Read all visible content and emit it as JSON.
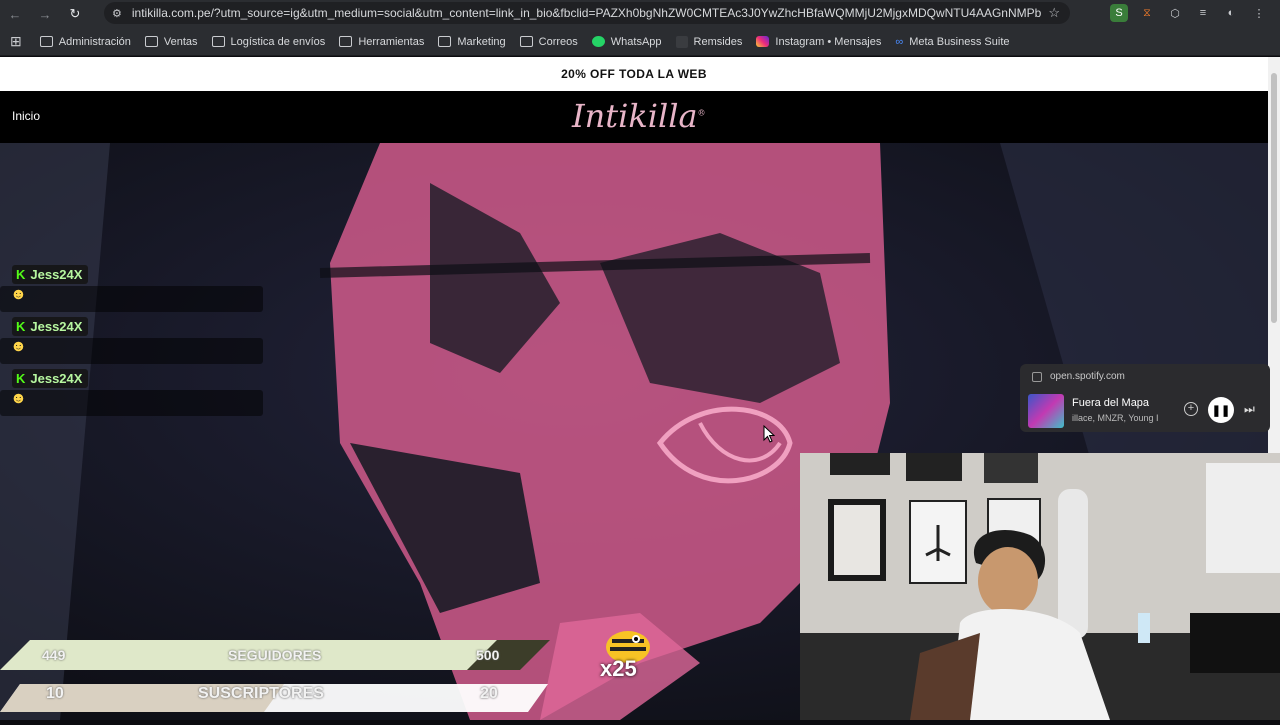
{
  "browser": {
    "url": "intikilla.com.pe/?utm_source=ig&utm_medium=social&utm_content=link_in_bio&fbclid=PAZXh0bgNhZW0CMTEAc3J0YwZhcHBfaWQMMjU2MjgxMDQwNTU4AAGnNMPbuFk...",
    "nav_back": "←",
    "nav_forward": "→",
    "nav_reload": "↻",
    "site_info": "⚙",
    "bookmark_star": "☆",
    "apps_icon": "⊞",
    "extensions": [
      "S",
      "⧖",
      "⬡",
      "≡",
      "◐",
      "⋮"
    ]
  },
  "bookmarks": [
    {
      "label": "Administración",
      "icon": "folder-icon"
    },
    {
      "label": "Ventas",
      "icon": "folder-icon"
    },
    {
      "label": "Logística de envíos",
      "icon": "folder-icon"
    },
    {
      "label": "Herramientas",
      "icon": "folder-icon"
    },
    {
      "label": "Marketing",
      "icon": "folder-icon"
    },
    {
      "label": "Correos",
      "icon": "folder-icon"
    },
    {
      "label": "WhatsApp",
      "icon": "whatsapp-icon"
    },
    {
      "label": "Remsides",
      "icon": "remsides-icon"
    },
    {
      "label": "Instagram • Mensajes",
      "icon": "instagram-icon"
    },
    {
      "label": "Meta Business Suite",
      "icon": "meta-icon"
    }
  ],
  "site": {
    "promo": "20% OFF TODA LA WEB",
    "nav_home": "Inicio",
    "logo": "Intikilla",
    "logo_mark": "®"
  },
  "chat": [
    {
      "badge": "K",
      "user": "Jess24X",
      "emote": "☻"
    },
    {
      "badge": "K",
      "user": "Jess24X",
      "emote": "☻"
    },
    {
      "badge": "K",
      "user": "Jess24X",
      "emote": "☻"
    }
  ],
  "spotify": {
    "source": "open.spotify.com",
    "track": "Fuera del Mapa",
    "artists": "illace, MNZR, Young I",
    "add": "+",
    "pause": "❚❚",
    "next": "⏭"
  },
  "overlay": {
    "followers_current": "449",
    "followers_label": "SEGUIDORES",
    "followers_goal": "500",
    "followers_progress": 0.898,
    "subs_current": "10",
    "subs_label": "SUSCRIPTORES",
    "subs_goal": "20",
    "subs_progress": 0.5,
    "multiplier": "x25"
  },
  "colors": {
    "hoodie_print": "#e0689a",
    "hoodie": "#1a1b26",
    "kick_green": "#53fc18"
  }
}
